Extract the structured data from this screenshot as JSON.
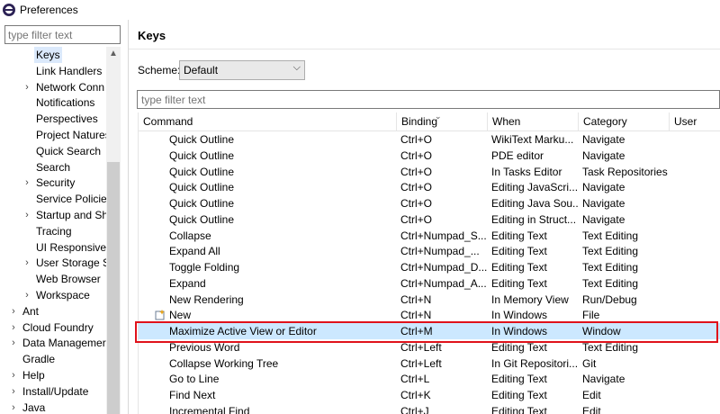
{
  "window": {
    "title": "Preferences"
  },
  "left": {
    "filter_placeholder": "type filter text",
    "tree": [
      {
        "label": "Keys",
        "indent": 2,
        "expander": false,
        "selected": true
      },
      {
        "label": "Link Handlers",
        "indent": 2,
        "expander": false
      },
      {
        "label": "Network Conn",
        "indent": 2,
        "expander": true
      },
      {
        "label": "Notifications",
        "indent": 2,
        "expander": false
      },
      {
        "label": "Perspectives",
        "indent": 2,
        "expander": false
      },
      {
        "label": "Project Natures",
        "indent": 2,
        "expander": false
      },
      {
        "label": "Quick Search",
        "indent": 2,
        "expander": false
      },
      {
        "label": "Search",
        "indent": 2,
        "expander": false
      },
      {
        "label": "Security",
        "indent": 2,
        "expander": true
      },
      {
        "label": "Service Policies",
        "indent": 2,
        "expander": false
      },
      {
        "label": "Startup and Sh",
        "indent": 2,
        "expander": true
      },
      {
        "label": "Tracing",
        "indent": 2,
        "expander": false
      },
      {
        "label": "UI Responsiven",
        "indent": 2,
        "expander": false
      },
      {
        "label": "User Storage S",
        "indent": 2,
        "expander": true
      },
      {
        "label": "Web Browser",
        "indent": 2,
        "expander": false
      },
      {
        "label": "Workspace",
        "indent": 2,
        "expander": true
      },
      {
        "label": "Ant",
        "indent": 1,
        "expander": true
      },
      {
        "label": "Cloud Foundry",
        "indent": 1,
        "expander": true
      },
      {
        "label": "Data Managemer",
        "indent": 1,
        "expander": true
      },
      {
        "label": "Gradle",
        "indent": 1,
        "expander": false
      },
      {
        "label": "Help",
        "indent": 1,
        "expander": true
      },
      {
        "label": "Install/Update",
        "indent": 1,
        "expander": true
      },
      {
        "label": "Java",
        "indent": 1,
        "expander": true
      }
    ]
  },
  "main": {
    "title": "Keys",
    "scheme_label": "Scheme:",
    "scheme_value": "Default",
    "filter_placeholder": "type filter text",
    "columns": [
      "Command",
      "Binding",
      "When",
      "Category",
      "User"
    ],
    "rows": [
      {
        "command": "Quick Outline",
        "binding": "Ctrl+O",
        "when": "WikiText Marku...",
        "category": "Navigate"
      },
      {
        "command": "Quick Outline",
        "binding": "Ctrl+O",
        "when": "PDE editor",
        "category": "Navigate"
      },
      {
        "command": "Quick Outline",
        "binding": "Ctrl+O",
        "when": "In Tasks Editor",
        "category": "Task Repositories"
      },
      {
        "command": "Quick Outline",
        "binding": "Ctrl+O",
        "when": "Editing JavaScri...",
        "category": "Navigate"
      },
      {
        "command": "Quick Outline",
        "binding": "Ctrl+O",
        "when": "Editing Java Sou...",
        "category": "Navigate"
      },
      {
        "command": "Quick Outline",
        "binding": "Ctrl+O",
        "when": "Editing in Struct...",
        "category": "Navigate"
      },
      {
        "command": "Collapse",
        "binding": "Ctrl+Numpad_S...",
        "when": "Editing Text",
        "category": "Text Editing"
      },
      {
        "command": "Expand All",
        "binding": "Ctrl+Numpad_...",
        "when": "Editing Text",
        "category": "Text Editing"
      },
      {
        "command": "Toggle Folding",
        "binding": "Ctrl+Numpad_D...",
        "when": "Editing Text",
        "category": "Text Editing"
      },
      {
        "command": "Expand",
        "binding": "Ctrl+Numpad_A...",
        "when": "Editing Text",
        "category": "Text Editing"
      },
      {
        "command": "New Rendering",
        "binding": "Ctrl+N",
        "when": "In Memory View",
        "category": "Run/Debug"
      },
      {
        "command": "New",
        "binding": "Ctrl+N",
        "when": "In Windows",
        "category": "File",
        "icon": "new-wizard-icon"
      },
      {
        "command": "Maximize Active View or Editor",
        "binding": "Ctrl+M",
        "when": "In Windows",
        "category": "Window",
        "selected": true
      },
      {
        "command": "Previous Word",
        "binding": "Ctrl+Left",
        "when": "Editing Text",
        "category": "Text Editing"
      },
      {
        "command": "Collapse Working Tree",
        "binding": "Ctrl+Left",
        "when": "In Git Repositori...",
        "category": "Git"
      },
      {
        "command": "Go to Line",
        "binding": "Ctrl+L",
        "when": "Editing Text",
        "category": "Navigate"
      },
      {
        "command": "Find Next",
        "binding": "Ctrl+K",
        "when": "Editing Text",
        "category": "Edit"
      },
      {
        "command": "Incremental Find",
        "binding": "Ctrl+J",
        "when": "Editing Text",
        "category": "Edit"
      }
    ]
  },
  "colors": {
    "selection": "#cce8ff",
    "highlight_outline": "#e0121b",
    "tree_selection": "#dbe9fb"
  }
}
